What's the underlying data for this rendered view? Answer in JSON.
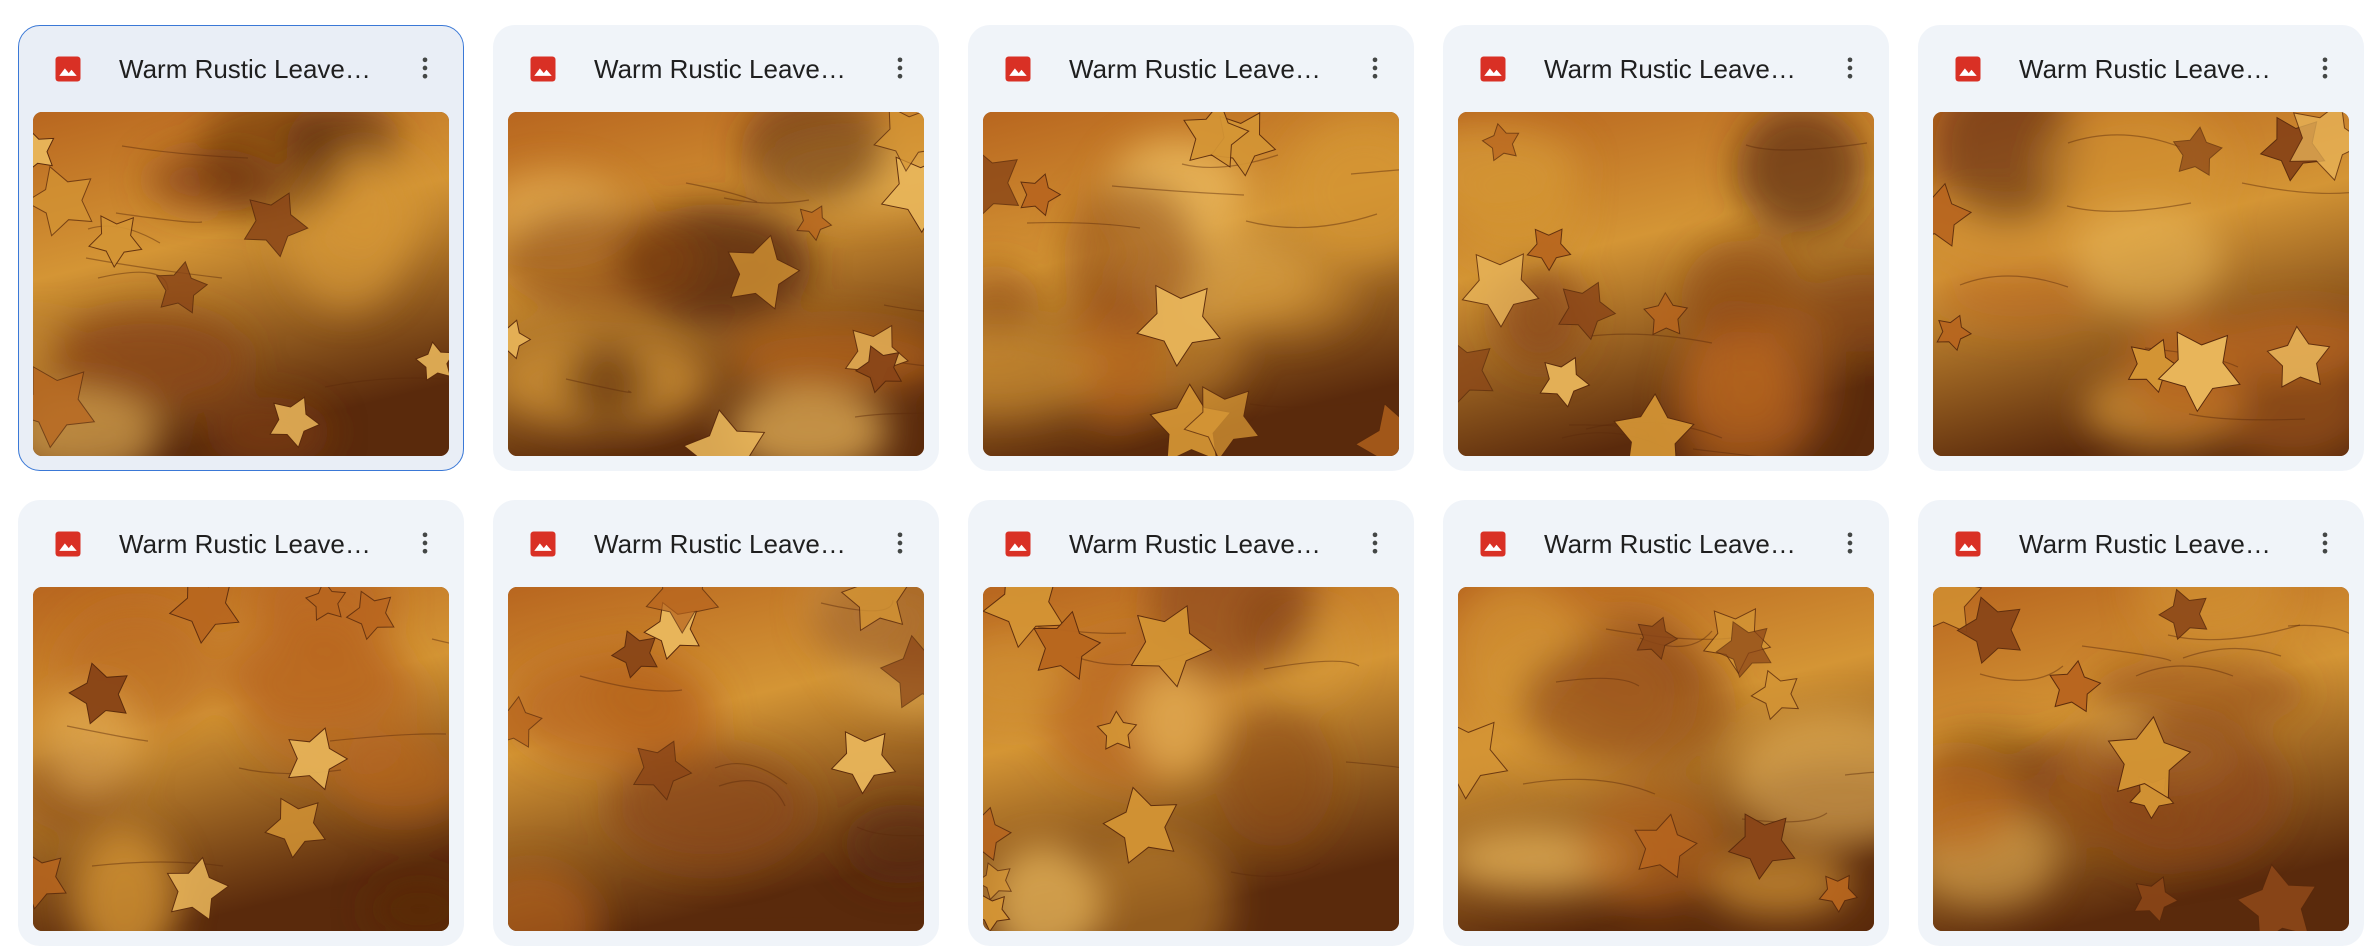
{
  "files": [
    {
      "name": "Warm Rustic Leaves...",
      "type_icon": "image-file-icon",
      "menu_icon": "more-vert-icon",
      "selected": true
    },
    {
      "name": "Warm Rustic Leaves...",
      "type_icon": "image-file-icon",
      "menu_icon": "more-vert-icon",
      "selected": false
    },
    {
      "name": "Warm Rustic Leaves...",
      "type_icon": "image-file-icon",
      "menu_icon": "more-vert-icon",
      "selected": false
    },
    {
      "name": "Warm Rustic Leaves...",
      "type_icon": "image-file-icon",
      "menu_icon": "more-vert-icon",
      "selected": false
    },
    {
      "name": "Warm Rustic Leaves...",
      "type_icon": "image-file-icon",
      "menu_icon": "more-vert-icon",
      "selected": false
    },
    {
      "name": "Warm Rustic Leaves...",
      "type_icon": "image-file-icon",
      "menu_icon": "more-vert-icon",
      "selected": false
    },
    {
      "name": "Warm Rustic Leaves...",
      "type_icon": "image-file-icon",
      "menu_icon": "more-vert-icon",
      "selected": false
    },
    {
      "name": "Warm Rustic Leaves...",
      "type_icon": "image-file-icon",
      "menu_icon": "more-vert-icon",
      "selected": false
    },
    {
      "name": "Warm Rustic Leaves...",
      "type_icon": "image-file-icon",
      "menu_icon": "more-vert-icon",
      "selected": false
    },
    {
      "name": "Warm Rustic Leaves...",
      "type_icon": "image-file-icon",
      "menu_icon": "more-vert-icon",
      "selected": false
    }
  ],
  "colors": {
    "card_background": "#f0f4f9",
    "selected_border": "#3a78d6",
    "image_icon": "#d93025",
    "text": "#1f1f1f",
    "thumbnail_palette": [
      "#5a2a0c",
      "#8a4618",
      "#b8661f",
      "#d49535",
      "#e8b55a"
    ]
  }
}
